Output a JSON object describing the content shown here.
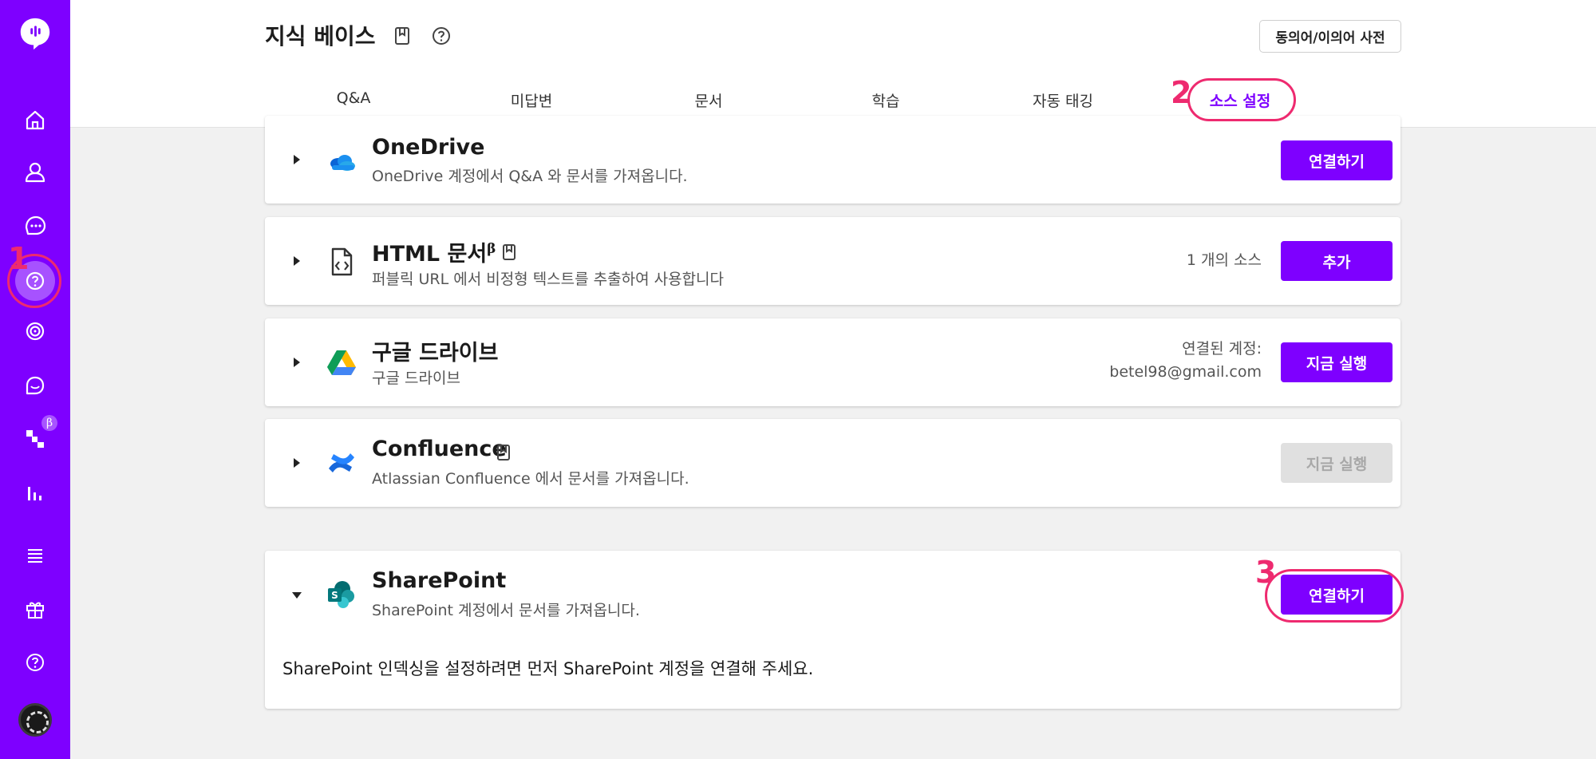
{
  "header": {
    "title": "지식 베이스",
    "dictionary_button": "동의어/이의어 사전",
    "tabs": [
      {
        "label": "Q&A"
      },
      {
        "label": "미답변"
      },
      {
        "label": "문서"
      },
      {
        "label": "학습"
      },
      {
        "label": "자동 태깅"
      },
      {
        "label": "소스 설정",
        "active": true
      }
    ]
  },
  "sidebar": {
    "icons": [
      "logo-icon",
      "home-icon",
      "user-icon",
      "chat-icon",
      "knowledge-base-icon",
      "target-icon",
      "conversation-icon",
      "workflow-icon",
      "chart-icon",
      "list-icon",
      "gift-icon",
      "help-icon",
      "avatar"
    ],
    "beta_badge": "β"
  },
  "sources": [
    {
      "name": "OneDrive",
      "description": "OneDrive 계정에서 Q&A 와 문서를 가져옵니다.",
      "button": "연결하기",
      "logo": "onedrive-icon"
    },
    {
      "name": "HTML 문서",
      "superscript": "β",
      "description": "퍼블릭 URL 에서 비정형 텍스트를 추출하여 사용합니다",
      "meta": "1 개의 소스",
      "button": "추가",
      "logo": "html-file-icon"
    },
    {
      "name": "구글 드라이브",
      "description": "구글 드라이브",
      "meta_label": "연결된 계정:",
      "meta_account": "betel98@gmail.com",
      "button": "지금 실행",
      "logo": "google-drive-icon"
    },
    {
      "name": "Confluence",
      "description": "Atlassian Confluence 에서 문서를 가져옵니다.",
      "button": "지금 실행",
      "button_disabled": true,
      "logo": "confluence-icon"
    },
    {
      "name": "SharePoint",
      "description": "SharePoint 계정에서 문서를 가져옵니다.",
      "button": "연결하기",
      "expanded_note": "SharePoint 인덱싱을 설정하려면 먼저 SharePoint 계정을 연결해 주세요.",
      "logo": "sharepoint-icon"
    }
  ],
  "annotations": [
    {
      "number": "1"
    },
    {
      "number": "2"
    },
    {
      "number": "3"
    }
  ],
  "colors": {
    "brand": "#7e00ff",
    "annotation": "#ee2a6f",
    "background": "#f1f1f1"
  }
}
